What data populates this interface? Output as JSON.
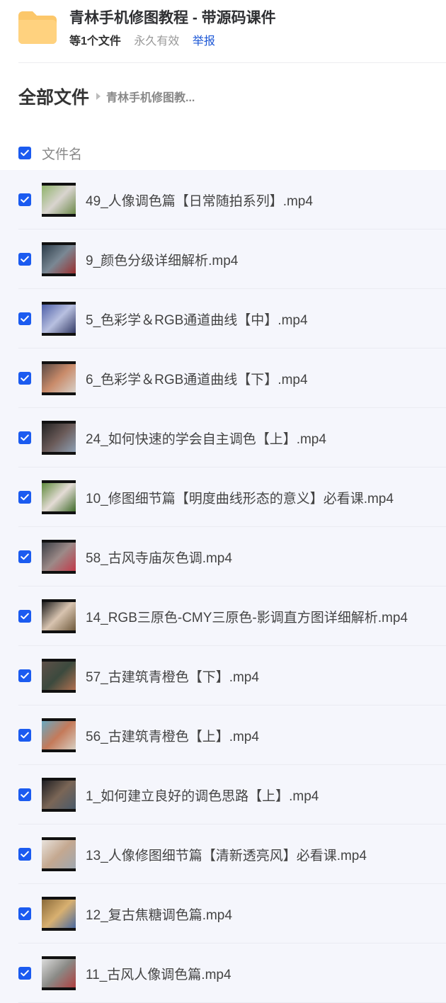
{
  "share": {
    "title": "青林手机修图教程 - 带源码课件",
    "count_label": "等1个文件",
    "validity": "永久有效",
    "report_label": "举报"
  },
  "breadcrumb": {
    "root": "全部文件",
    "current": "青林手机修图教..."
  },
  "list_header": {
    "column_name": "文件名",
    "all_checked": true
  },
  "colors": {
    "accent": "#1b5bf0",
    "link": "#1a56d6",
    "folder": "#fcc76a",
    "list_bg": "#f5f6fc"
  },
  "files": [
    {
      "name": "49_人像调色篇【日常随拍系列】.mp4",
      "checked": true,
      "thumb": [
        "#8fb36a",
        "#d9d4cf",
        "#6d8a4a"
      ]
    },
    {
      "name": "9_颜色分级详细解析.mp4",
      "checked": true,
      "thumb": [
        "#2b3b48",
        "#7a8894",
        "#9a2f2f"
      ]
    },
    {
      "name": "5_色彩学＆RGB通道曲线【中】.mp4",
      "checked": true,
      "thumb": [
        "#4d5fa8",
        "#b8c0e0",
        "#333a66"
      ]
    },
    {
      "name": "6_色彩学＆RGB通道曲线【下】.mp4",
      "checked": true,
      "thumb": [
        "#5a4a44",
        "#c98b6a",
        "#d7d0c8"
      ]
    },
    {
      "name": "24_如何快速的学会自主调色【上】.mp4",
      "checked": true,
      "thumb": [
        "#222222",
        "#6a5a58",
        "#8ea0b4"
      ]
    },
    {
      "name": "10_修图细节篇【明度曲线形态的意义】必看课.mp4",
      "checked": true,
      "thumb": [
        "#5f8a3c",
        "#e4dcd6",
        "#3f6b2a"
      ]
    },
    {
      "name": "58_古风寺庙灰色调.mp4",
      "checked": true,
      "thumb": [
        "#3a3e44",
        "#9c8a88",
        "#c23a4a"
      ]
    },
    {
      "name": "14_RGB三原色-CMY三原色-影调直方图详细解析.mp4",
      "checked": true,
      "thumb": [
        "#1c1c1c",
        "#d8c4b0",
        "#6f5a3c"
      ]
    },
    {
      "name": "57_古建筑青橙色【下】.mp4",
      "checked": true,
      "thumb": [
        "#5e5048",
        "#3c4a3e",
        "#b07050"
      ]
    },
    {
      "name": "56_古建筑青橙色【上】.mp4",
      "checked": true,
      "thumb": [
        "#6aa8c0",
        "#c47a5a",
        "#d8cfc2"
      ]
    },
    {
      "name": "1_如何建立良好的调色思路【上】.mp4",
      "checked": true,
      "thumb": [
        "#1e1e22",
        "#7a6656",
        "#4a5a6a"
      ]
    },
    {
      "name": "13_人像修图细节篇【清新透亮风】必看课.mp4",
      "checked": true,
      "thumb": [
        "#e8e2dc",
        "#c4a890",
        "#a0a8b0"
      ]
    },
    {
      "name": "12_复古焦糖调色篇.mp4",
      "checked": true,
      "thumb": [
        "#8a6a3a",
        "#d8b070",
        "#4a6aa0"
      ]
    },
    {
      "name": "11_古风人像调色篇.mp4",
      "checked": true,
      "thumb": [
        "#dcdcdc",
        "#8a8a86",
        "#b04040"
      ]
    }
  ]
}
